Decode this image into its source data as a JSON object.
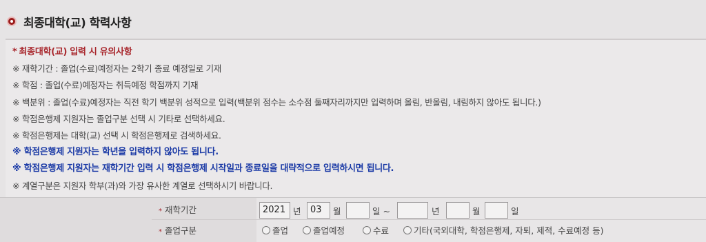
{
  "section": {
    "title": "최종대학(교) 학력사항"
  },
  "notice": {
    "title": "최종대학(교) 입력 시 유의사항",
    "lines": [
      {
        "text": "※ 재학기간 : 졸업(수료)예정자는 2학기 종료 예정일로 기재",
        "style": "normal"
      },
      {
        "text": "※ 학점 : 졸업(수료)예정자는 취득예정 학점까지 기재",
        "style": "normal"
      },
      {
        "text": "※ 백분위 : 졸업(수료)예정자는 직전 학기 백분위 성적으로 입력(백분위 점수는 소수점 둘째자리까지만 입력하며 올림, 반올림, 내림하지 않아도 됩니다.)",
        "style": "normal"
      },
      {
        "text": "※ 학점은행제 지원자는 졸업구분 선택 시 기타로 선택하세요.",
        "style": "normal"
      },
      {
        "text": "※ 학점은행제는 대학(교) 선택 시 학점은행제로 검색하세요.",
        "style": "normal"
      },
      {
        "text": "※ 학점은행제 지원자는 학년을 입력하지 않아도 됩니다.",
        "style": "emph"
      },
      {
        "text": "※ 학점은행제 지원자는 재학기간 입력 시 학점은행제 시작일과 종료일을 대략적으로 입력하시면 됩니다.",
        "style": "emph"
      },
      {
        "text": "※ 계열구분은 지원자 학부(과)와 가장 유사한 계열로 선택하시기 바랍니다.",
        "style": "normal"
      }
    ]
  },
  "form": {
    "period": {
      "label": "재학기간",
      "start_year": "2021",
      "start_month": "03",
      "start_day": "",
      "end_year": "",
      "end_month": "",
      "end_day": "",
      "unit_year": "년",
      "unit_month": "월",
      "unit_day": "일",
      "unit_day_tilde": "일 ~"
    },
    "graduation": {
      "label": "졸업구분",
      "options": [
        "졸업",
        "졸업예정",
        "수료",
        "기타(국외대학, 학점은행제, 자퇴, 제적, 수료예정 등)"
      ]
    }
  }
}
